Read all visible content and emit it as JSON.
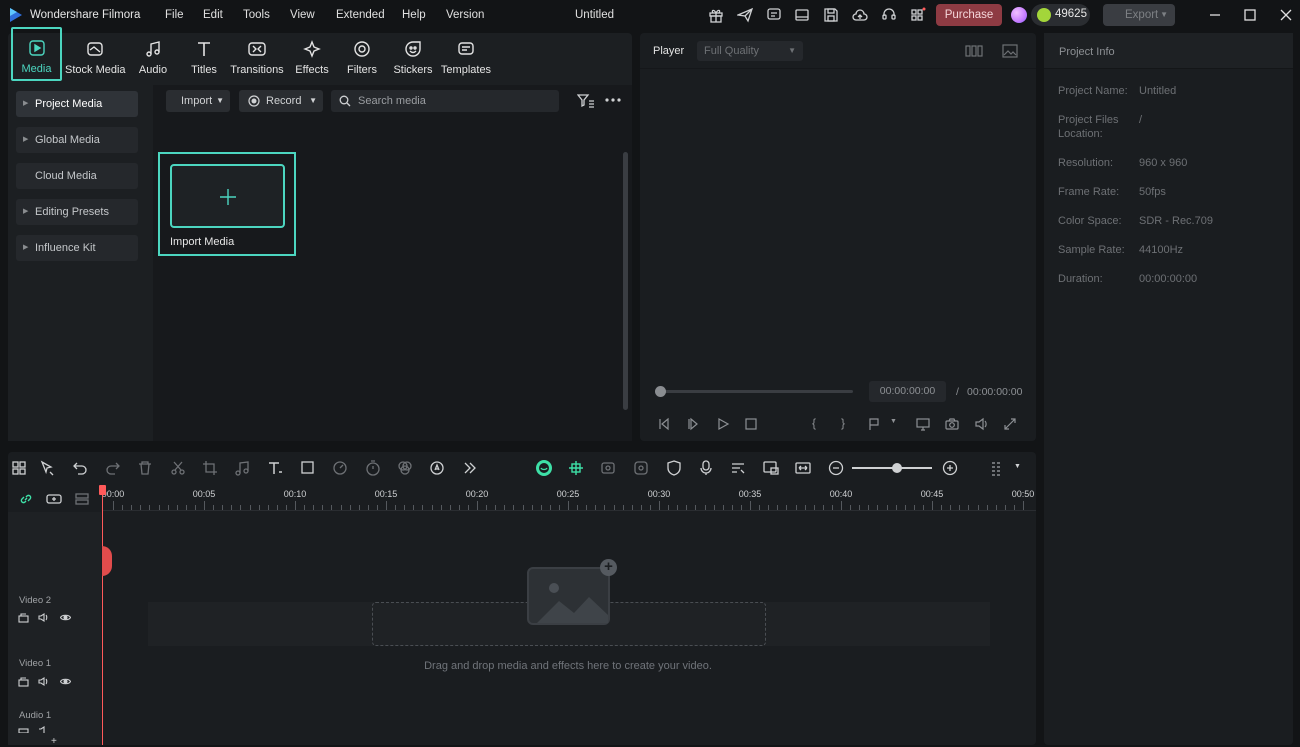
{
  "app": {
    "name": "Wondershare Filmora",
    "doc_title": "Untitled"
  },
  "menu": [
    "File",
    "Edit",
    "Tools",
    "View",
    "Extended",
    "Help",
    "Version"
  ],
  "header": {
    "purchase_label": "Purchase",
    "credits": "49625",
    "export_label": "Export"
  },
  "tabs": [
    "Media",
    "Stock Media",
    "Audio",
    "Titles",
    "Transitions",
    "Effects",
    "Filters",
    "Stickers",
    "Templates"
  ],
  "sidebar": [
    {
      "label": "Project Media"
    },
    {
      "label": "Global Media"
    },
    {
      "label": "Cloud Media"
    },
    {
      "label": "Editing Presets"
    },
    {
      "label": "Influence Kit"
    }
  ],
  "media_toolbar": {
    "import_label": "Import",
    "record_label": "Record",
    "search_placeholder": "Search media"
  },
  "import_card": {
    "label": "Import Media"
  },
  "player": {
    "label": "Player",
    "quality": "Full Quality",
    "current_time": "00:00:00:00",
    "separator": "/",
    "total_time": "00:00:00:00"
  },
  "project_info": {
    "title": "Project Info",
    "rows": [
      {
        "key": "Project Name:",
        "value": "Untitled"
      },
      {
        "key": "Project Files Location:",
        "value": "/"
      },
      {
        "key": "Resolution:",
        "value": "960 x 960"
      },
      {
        "key": "Frame Rate:",
        "value": "50fps"
      },
      {
        "key": "Color Space:",
        "value": "SDR - Rec.709"
      },
      {
        "key": "Sample Rate:",
        "value": "44100Hz"
      },
      {
        "key": "Duration:",
        "value": "00:00:00:00"
      }
    ]
  },
  "timeline": {
    "ruler": [
      "00:00",
      "00:05",
      "00:10",
      "00:15",
      "00:20",
      "00:25",
      "00:30",
      "00:35",
      "00:40",
      "00:45",
      "00:50"
    ],
    "tracks": [
      "Video 2",
      "Video 1",
      "Audio 1"
    ],
    "drop_hint": "Drag and drop media and effects here to create your video."
  },
  "colors": {
    "accent": "#4cd6c0",
    "purchase": "#8e3b43",
    "playhead": "#ff5a5a"
  }
}
